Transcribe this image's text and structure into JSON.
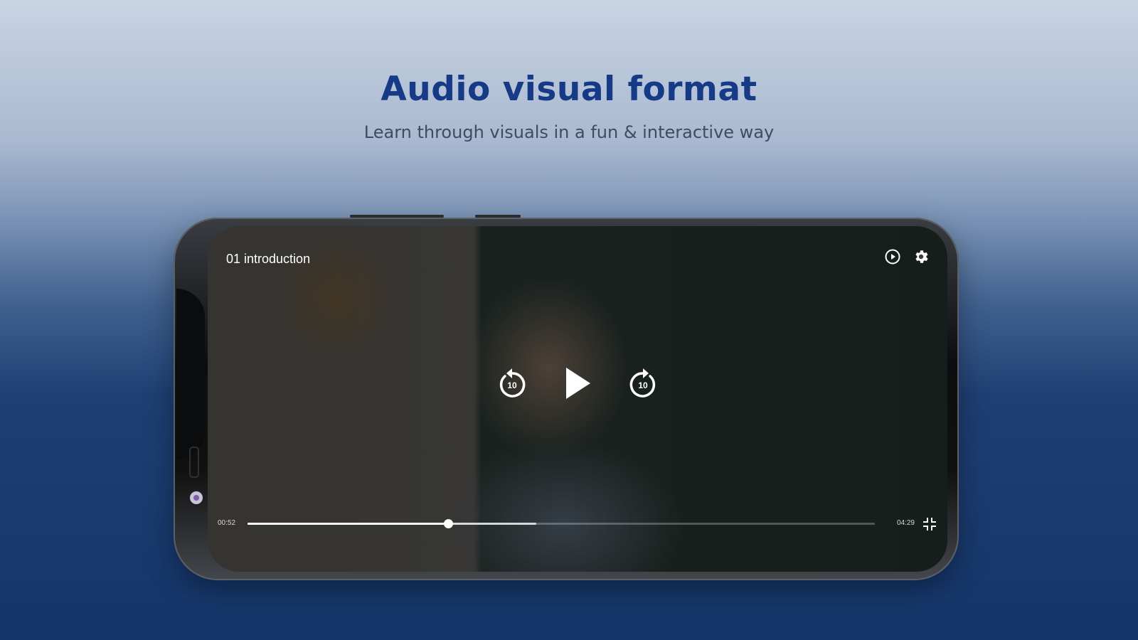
{
  "hero": {
    "headline": "Audio visual format",
    "subline": "Learn through visuals in a fun & interactive way"
  },
  "player": {
    "title": "01 introduction",
    "current_time": "00:52",
    "duration": "04:29",
    "progress": 0.32,
    "buffered": 0.46,
    "rewind_seconds": "10",
    "forward_seconds": "10",
    "icons": {
      "speed": "playback-speed-icon",
      "settings": "gear-icon",
      "rewind": "rewind-10-icon",
      "play": "play-icon",
      "forward": "forward-10-icon",
      "fullscreen": "exit-fullscreen-icon"
    }
  },
  "colors": {
    "headline": "#173a86",
    "subline": "#3e4b60",
    "control": "#ffffff"
  }
}
